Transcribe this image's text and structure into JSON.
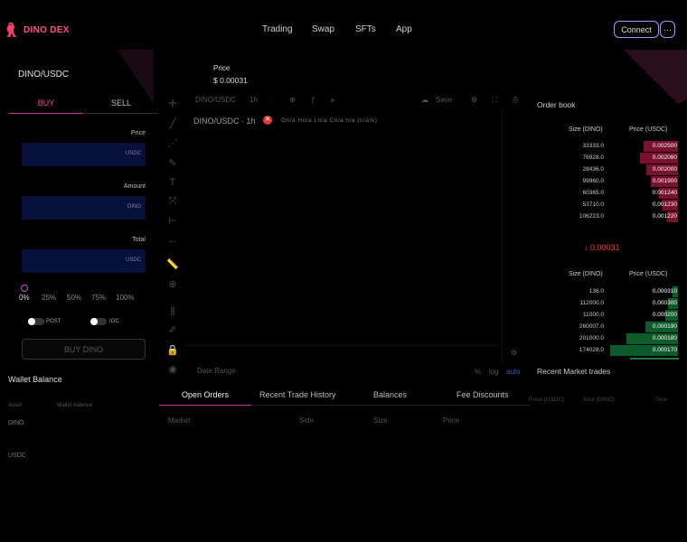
{
  "brand": {
    "name": "DINO DEX",
    "accent": "#ff4d8d",
    "mascot_icon": "dino-icon"
  },
  "nav": [
    {
      "label": "Trading"
    },
    {
      "label": "Swap"
    },
    {
      "label": "SFTs"
    },
    {
      "label": "App"
    }
  ],
  "header": {
    "connect_label": "Connect",
    "more_label": "···"
  },
  "market": {
    "pair": "DINO/USDC",
    "price_label": "Price",
    "price_value": "$ 0.00031"
  },
  "trade": {
    "tabs": {
      "buy": "BUY",
      "sell": "SELL"
    },
    "price_label": "Price",
    "price_unit": "USDC",
    "amount_label": "Amount",
    "amount_unit": "DINO",
    "total_label": "Total",
    "total_unit": "USDC",
    "percent_options": [
      "0%",
      "25%",
      "50%",
      "75%",
      "100%"
    ],
    "toggle_post": "POST",
    "toggle_ioc": "IOC",
    "buy_button": "BUY DINO"
  },
  "wallet": {
    "title": "Wallet Balance",
    "col_asset": "Asset",
    "col_wallet": "Wallet balance",
    "assets": [
      "DINO",
      "USDC"
    ]
  },
  "chart": {
    "toolbar_symbol": "DINO/USDC",
    "toolbar_interval": "1h",
    "save_label": "Save",
    "title": "DINO/USDC · 1h",
    "ohlc": "On/a Hn/a Ln/a Cn/a n/a (n/a%)",
    "date_range": "Date Range",
    "scale_pct": "%",
    "scale_log": "log",
    "scale_auto": "auto"
  },
  "bottom_tabs": {
    "items": [
      "Open Orders",
      "Recent Trade History",
      "Balances",
      "Fee Discounts"
    ],
    "active": "Open Orders",
    "columns": [
      "Market",
      "Side",
      "Size",
      "Price"
    ]
  },
  "order_book": {
    "title": "Order book",
    "col_size": "Size (DINO)",
    "col_price": "Price (USDC)",
    "asks": [
      {
        "size": "33333.0",
        "price": "0.002500",
        "depth": 0.25
      },
      {
        "size": "76928.0",
        "price": "0.002080",
        "depth": 0.28
      },
      {
        "size": "28436.0",
        "price": "0.002000",
        "depth": 0.23
      },
      {
        "size": "99960.0",
        "price": "0.001900",
        "depth": 0.2
      },
      {
        "size": "60365.0",
        "price": "0.001240",
        "depth": 0.14
      },
      {
        "size": "53710.0",
        "price": "0.001230",
        "depth": 0.11
      },
      {
        "size": "106223.0",
        "price": "0.001220",
        "depth": 0.08
      }
    ],
    "mid": "↓ 0.00031",
    "mid_color": "#ff3b3b",
    "bids": [
      {
        "size": "136.0",
        "price": "0.000310",
        "depth": 0.04
      },
      {
        "size": "112000.0",
        "price": "0.000300",
        "depth": 0.07
      },
      {
        "size": "11000.0",
        "price": "0.000200",
        "depth": 0.09
      },
      {
        "size": "260007.0",
        "price": "0.000190",
        "depth": 0.24
      },
      {
        "size": "201000.0",
        "price": "0.000180",
        "depth": 0.38
      },
      {
        "size": "174028.0",
        "price": "0.000170",
        "depth": 0.5
      }
    ]
  },
  "recent_trades": {
    "title": "Recent Market trades",
    "columns": [
      "Price (USDC)",
      "Size (DINO)",
      "Time"
    ]
  }
}
